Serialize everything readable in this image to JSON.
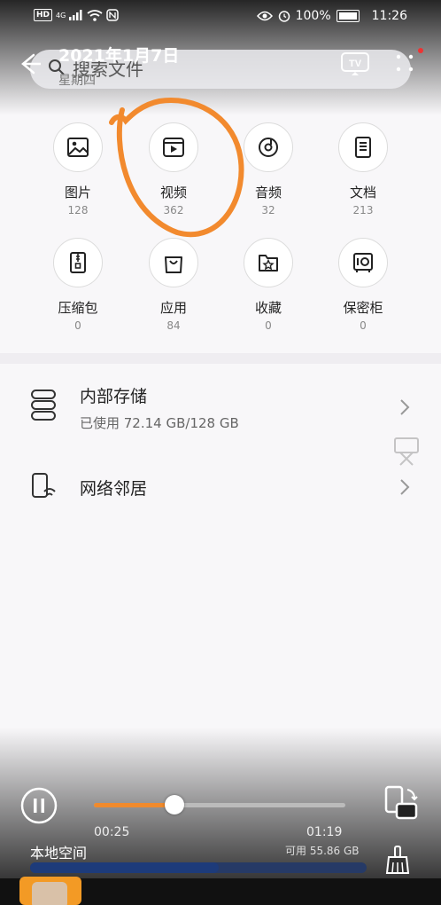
{
  "status_bar": {
    "hd": "HD",
    "network": "4G",
    "battery": "100%",
    "time": "11:26"
  },
  "video_overlay": {
    "title": "2021年1月7日",
    "elapsed": "00:25",
    "duration": "01:19",
    "progress": 0.32,
    "tv_label": "TV"
  },
  "search": {
    "placeholder": "搜索文件",
    "subtext": "星期四"
  },
  "categories": [
    {
      "label": "图片",
      "count": "128",
      "icon": "image-icon"
    },
    {
      "label": "视频",
      "count": "362",
      "icon": "video-icon"
    },
    {
      "label": "音频",
      "count": "32",
      "icon": "audio-icon"
    },
    {
      "label": "文档",
      "count": "213",
      "icon": "document-icon"
    },
    {
      "label": "压缩包",
      "count": "0",
      "icon": "archive-icon"
    },
    {
      "label": "应用",
      "count": "84",
      "icon": "app-bag-icon"
    },
    {
      "label": "收藏",
      "count": "0",
      "icon": "favorite-icon"
    },
    {
      "label": "保密柜",
      "count": "0",
      "icon": "safe-icon"
    }
  ],
  "locations": [
    {
      "title": "内部存储",
      "subtitle": "已使用 72.14 GB/128 GB",
      "icon": "storage-icon"
    },
    {
      "title": "网络邻居",
      "subtitle": "",
      "icon": "network-neighbor-icon"
    }
  ],
  "bottom": {
    "storage_label": "本地空间",
    "available": "可用 55.86 GB",
    "used_fraction": 0.56
  },
  "colors": {
    "accent": "#f08a2c",
    "annotation": "#f28a2e"
  }
}
